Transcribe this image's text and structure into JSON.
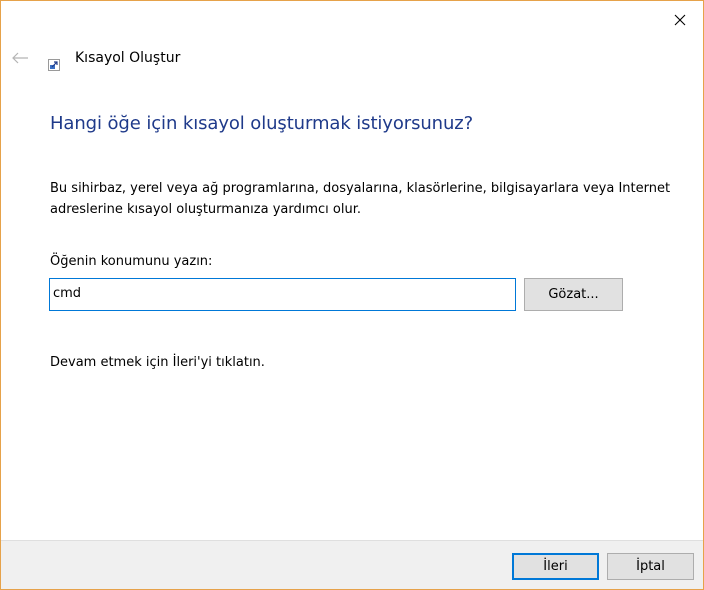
{
  "window": {
    "title": "Kısayol Oluştur",
    "accent_border_color": "#e6a24a"
  },
  "nav": {
    "back_icon": "arrow-left-icon",
    "close_icon": "close-icon",
    "app_icon": "shortcut-icon"
  },
  "main": {
    "heading": "Hangi öğe için kısayol oluşturmak istiyorsunuz?",
    "heading_color": "#1f3a8a",
    "description": "Bu sihirbaz, yerel veya ağ programlarına, dosyalarına, klasörlerine, bilgisayarlara veya Internet adreslerine kısayol oluşturmanıza yardımcı olur.",
    "location_label": "Öğenin konumunu yazın:",
    "location_value": "cmd",
    "browse_label": "Gözat...",
    "hint": "Devam etmek için İleri'yi tıklatın."
  },
  "footer": {
    "next_label": "İleri",
    "cancel_label": "İptal"
  }
}
